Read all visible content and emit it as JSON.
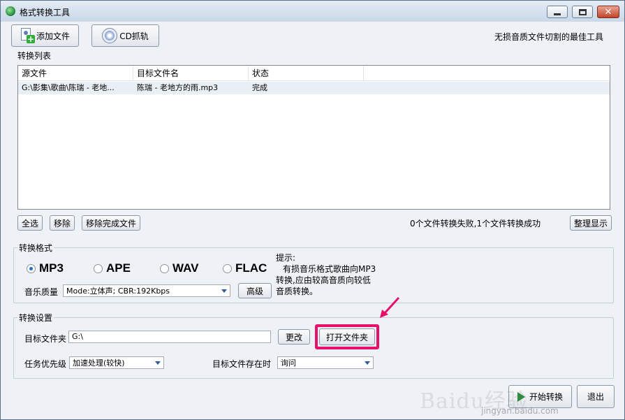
{
  "window": {
    "title": "格式转换工具",
    "min_label": "—",
    "max_label": "□",
    "close_label": "✕"
  },
  "toolbar": {
    "add_file": "添加文件",
    "cd_rip": "CD抓轨",
    "tagline": "无损音质文件切割的最佳工具"
  },
  "list_section": {
    "label": "转换列表",
    "columns": [
      "源文件",
      "目标文件名",
      "状态"
    ],
    "rows": [
      {
        "source": "G:\\影集\\歌曲\\陈瑞 - 老地...",
        "target": "陈瑞 - 老地方的雨.mp3",
        "status": "完成"
      }
    ]
  },
  "list_actions": {
    "select_all": "全选",
    "remove": "移除",
    "remove_done": "移除完成文件",
    "stats": "0个文件转换失败,1个文件转换成功",
    "tidy": "整理显示"
  },
  "format_section": {
    "label": "转换格式",
    "options": [
      "MP3",
      "APE",
      "WAV",
      "FLAC"
    ],
    "selected": "MP3",
    "quality_label": "音乐质量",
    "quality_value": "Mode:立体声; CBR:192Kbps",
    "advanced": "高级",
    "hint_lines": [
      "提示:",
      "有损音乐格式歌曲向MP3",
      "转换,应由较高音质向较低",
      "音质转换。"
    ]
  },
  "settings_section": {
    "label": "转换设置",
    "target_folder_label": "目标文件夹",
    "target_folder_value": "G:\\",
    "change": "更改",
    "open_folder": "打开文件夹",
    "priority_label": "任务优先级",
    "priority_value": "加速处理(较快)",
    "exists_label": "目标文件存在时",
    "exists_value": "询问"
  },
  "footer": {
    "start": "开始转换",
    "exit": "退出",
    "watermark": "Baidu经验",
    "watermark_url": "jingyan.baidu.com"
  },
  "colors": {
    "highlight": "#e8106a",
    "accent": "#1f6fc7"
  }
}
